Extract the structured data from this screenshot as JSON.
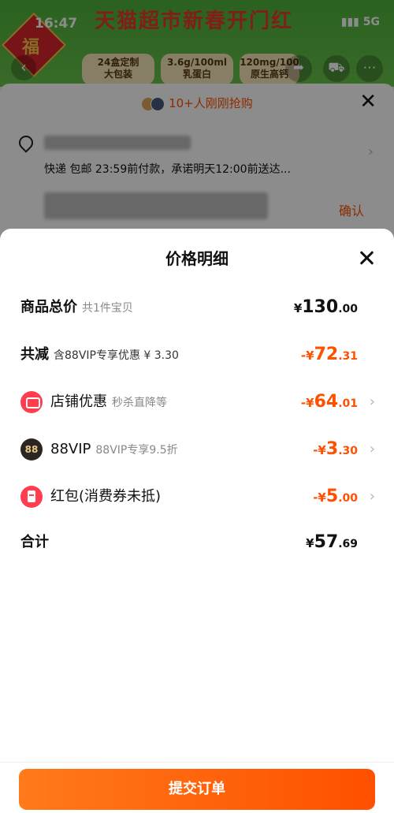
{
  "status_bar": {
    "time": "16:47",
    "network": "5G"
  },
  "background": {
    "banner_title": "天猫超市新春开门红",
    "badge_char": "福",
    "spec_pills": [
      {
        "line1": "24盒定制",
        "line2": "大包装"
      },
      {
        "line1": "3.6g/100ml",
        "line2": "乳蛋白"
      },
      {
        "line1": "120mg/100",
        "line2": "原生高钙"
      }
    ],
    "grab_text": "10+人刚刚抢购",
    "shipping_text": "快递 包邮 23:59前付款，承诺明天12:00前送达...",
    "confirm_label": "确认"
  },
  "price_detail": {
    "title": "价格明细",
    "rows": [
      {
        "label": "商品总价",
        "sub": "共1件宝贝",
        "cur": "¥",
        "int": "130",
        "dec": ".00"
      },
      {
        "label": "共减",
        "sub": "含88VIP专享优惠 ¥ 3.30",
        "cur": "-¥",
        "int": "72",
        "dec": ".31"
      },
      {
        "label": "店铺优惠",
        "sub": "秒杀直降等",
        "cur": "-¥",
        "int": "64",
        "dec": ".01",
        "icon": "store-icon"
      },
      {
        "label": "88VIP",
        "sub": "88VIP专享9.5折",
        "cur": "-¥",
        "int": "3",
        "dec": ".30",
        "icon": "vip-88-icon",
        "icon_text": "88"
      },
      {
        "label": "红包(消费券未抵)",
        "sub": "",
        "cur": "-¥",
        "int": "5",
        "dec": ".00",
        "icon": "red-packet-icon"
      },
      {
        "label": "合计",
        "sub": "",
        "cur": "¥",
        "int": "57",
        "dec": ".69"
      }
    ]
  },
  "submit_label": "提交订单",
  "colors": {
    "accent": "#ff5000",
    "store_icon": "#ff3d4f",
    "vip_icon": "#2c2420"
  }
}
